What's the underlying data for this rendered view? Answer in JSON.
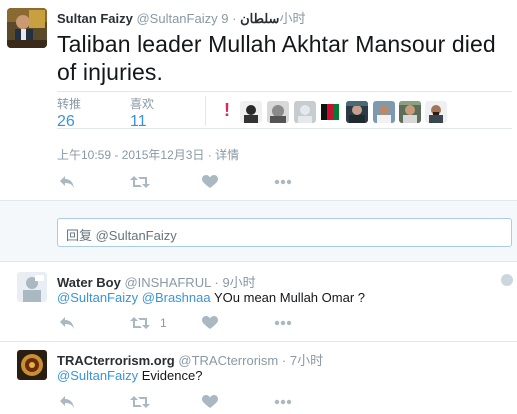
{
  "tweet": {
    "name": "Sultan Faizy",
    "handle": "@SultanFaizy",
    "arabic_name": "سلطان",
    "separator": "·",
    "time": "9小时",
    "text": "Taliban leader Mullah Akhtar Mansour died of injuries.",
    "retweets_label": "转推",
    "retweets_count": "26",
    "likes_label": "喜欢",
    "likes_count": "11",
    "timestamp": "上午10:59 - 2015年12月3日",
    "details_sep": " · ",
    "details_link": "详情"
  },
  "compose": {
    "placeholder": "回复 @SultanFaizy"
  },
  "replies": [
    {
      "name": "Water Boy",
      "handle": "@INSHAFRUL",
      "separator": "·",
      "time": "9小时",
      "mention1": "@SultanFaizy",
      "mention2": "@Brashnaa",
      "text": " YOu mean Mullah Omar ?",
      "retweet_count": "1"
    },
    {
      "name": "TRACterrorism.org",
      "handle": "@TRACterrorism",
      "separator": "·",
      "time": "7小时",
      "mention1": "@SultanFaizy",
      "text": " Evidence?"
    }
  ],
  "icons": {
    "reply": "reply-icon",
    "retweet": "retweet-icon",
    "like": "heart-icon",
    "more": "more-icon"
  },
  "colors": {
    "link": "#3b94d9",
    "muted": "#8899a6",
    "alert": "#e0245e"
  }
}
